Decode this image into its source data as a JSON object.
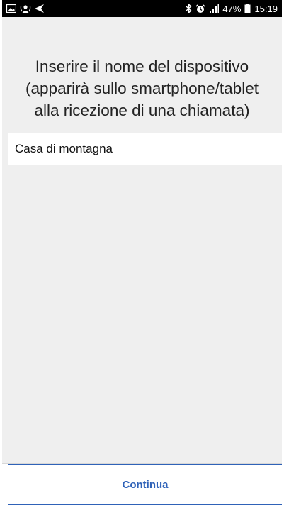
{
  "status_bar": {
    "battery_percent": "47%",
    "time": "15:19",
    "icons": [
      "gallery-icon",
      "contacts-sync-icon",
      "navigation-arrow-icon",
      "bluetooth-icon",
      "alarm-icon",
      "signal-icon",
      "battery-icon"
    ]
  },
  "prompt": {
    "line1": "Inserire il nome del dispositivo",
    "line2": "(apparirà sullo smartphone/tablet",
    "line3": "alla ricezione di una chiamata)"
  },
  "device_name": {
    "value": "Casa di montagna",
    "placeholder": ""
  },
  "actions": {
    "continue_label": "Continua"
  },
  "colors": {
    "accent": "#2f62b8",
    "background": "#efefef",
    "status_bar": "#000000"
  }
}
